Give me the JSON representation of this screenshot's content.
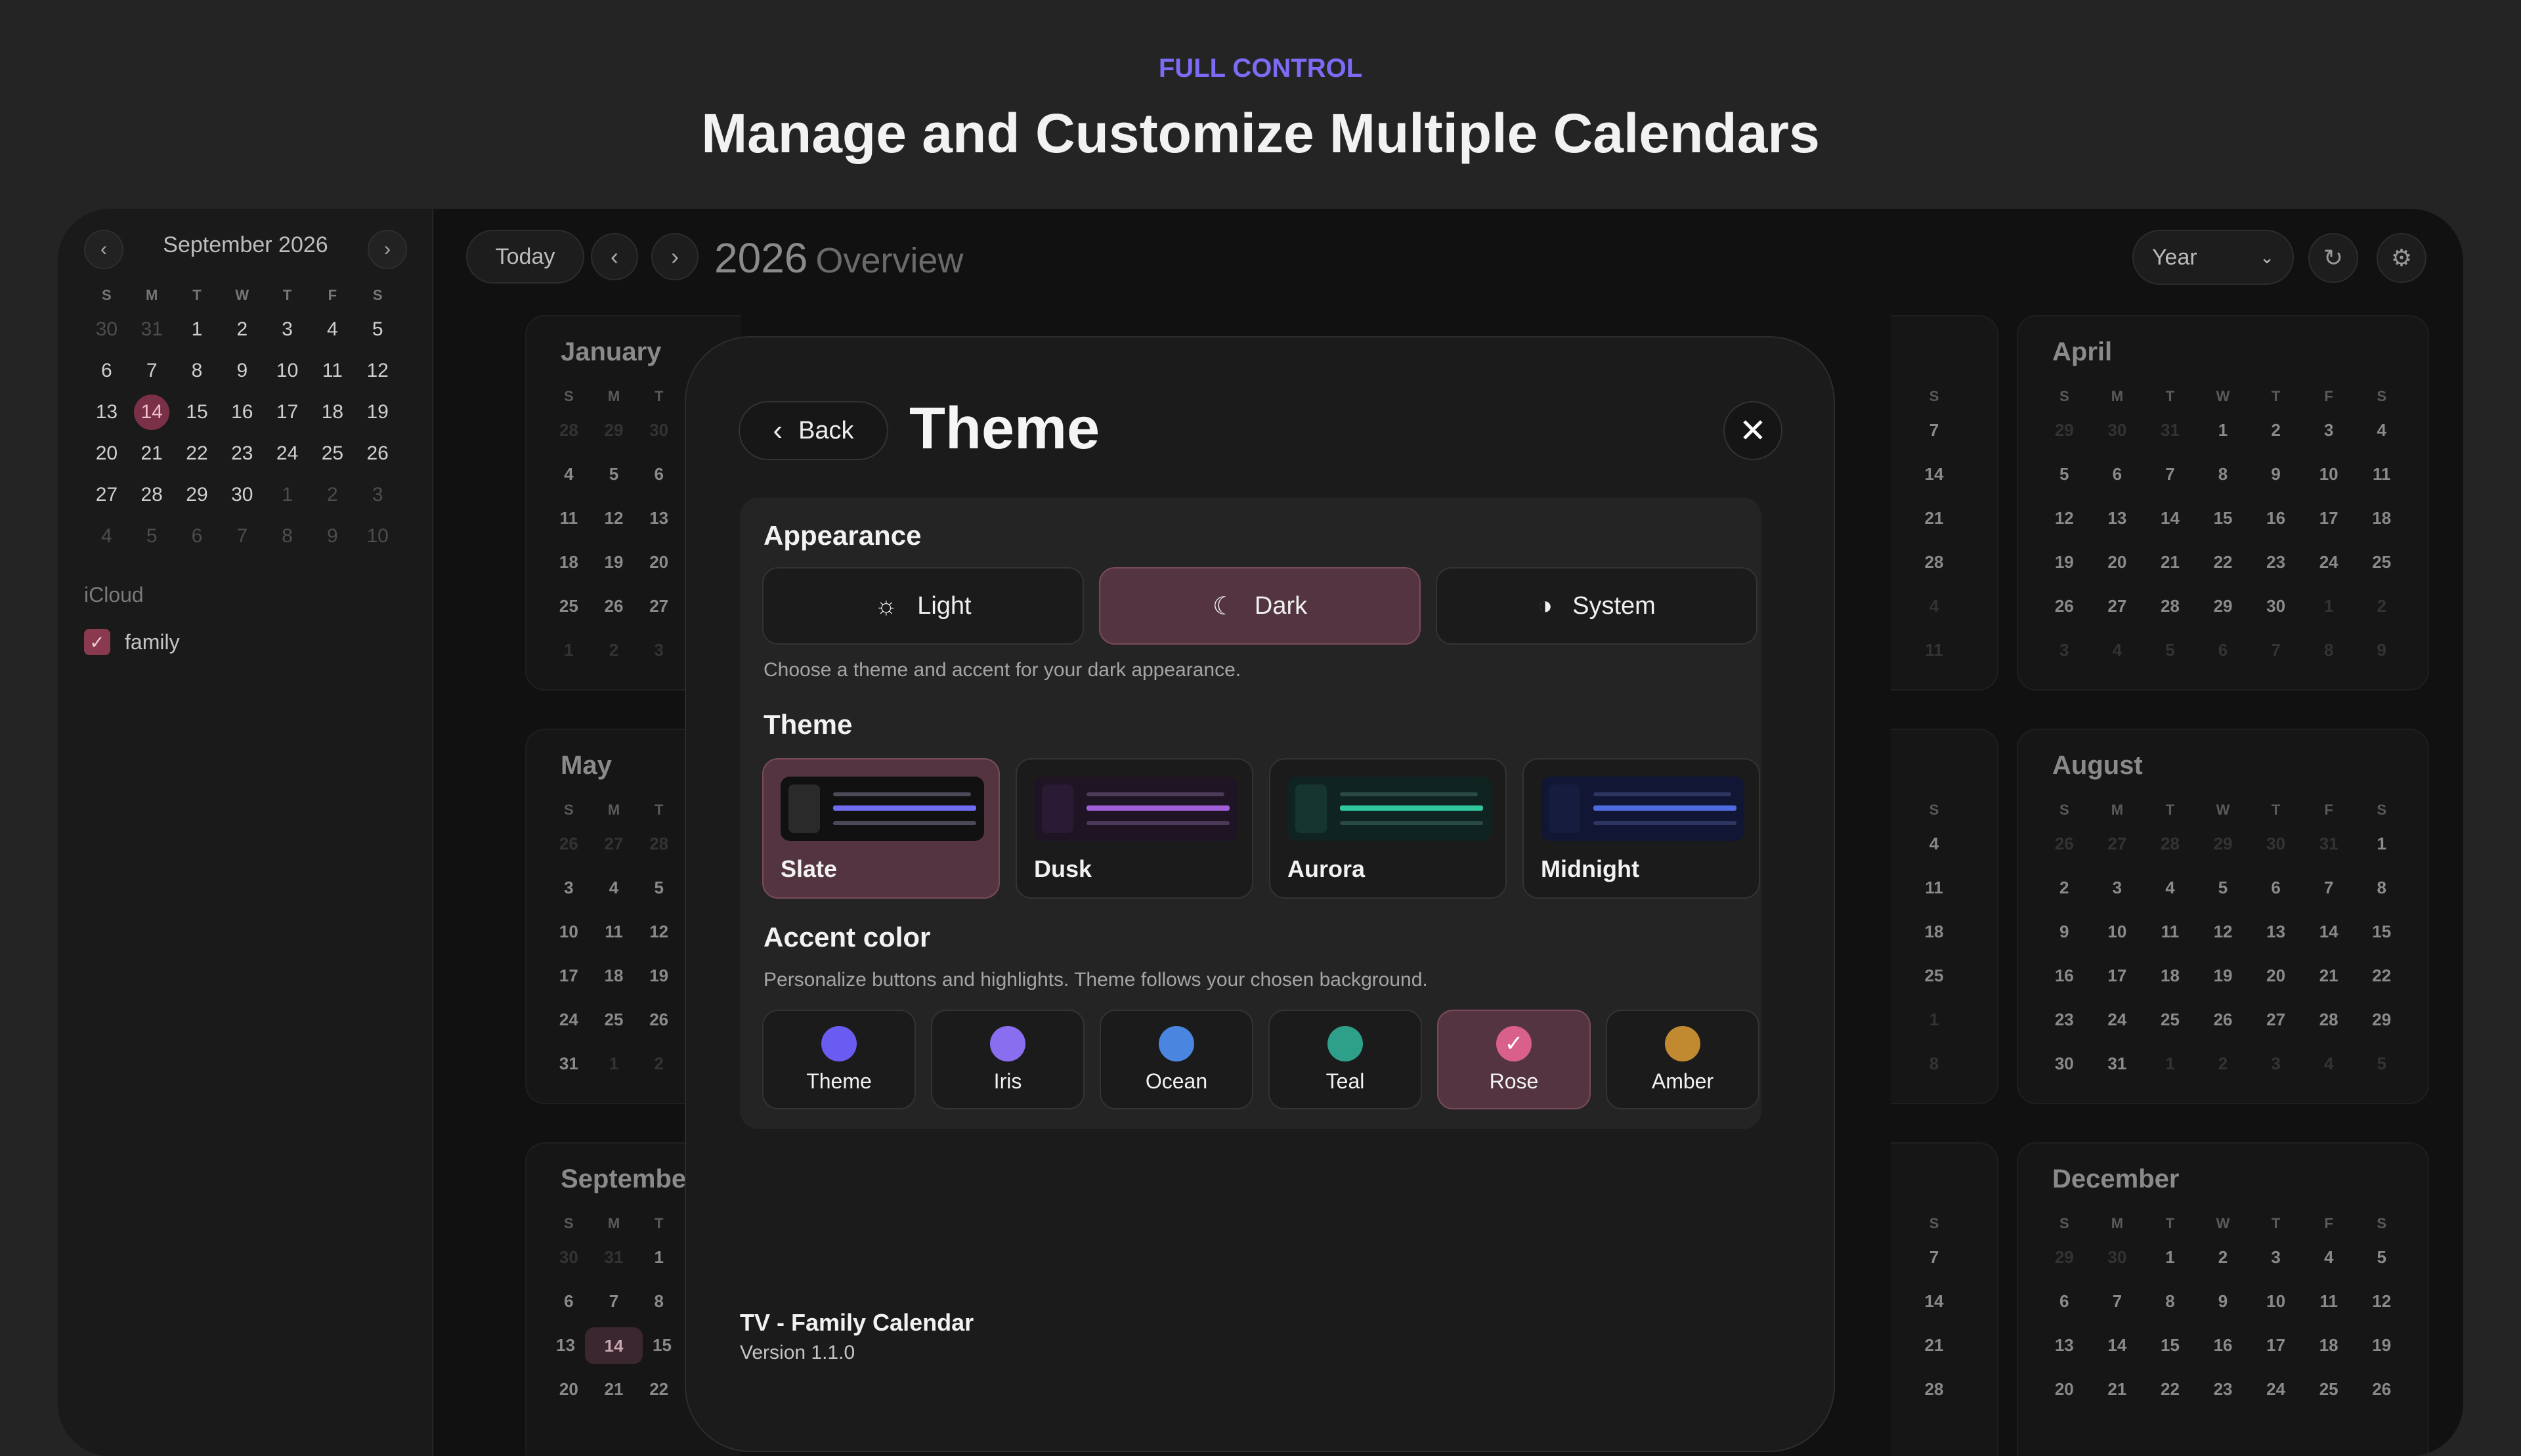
{
  "hero": {
    "eyebrow": "FULL CONTROL",
    "title": "Manage and Customize Multiple Calendars"
  },
  "sidebar": {
    "mini_calendar": {
      "title": "September 2026",
      "weekdays": [
        "S",
        "M",
        "T",
        "W",
        "T",
        "F",
        "S"
      ],
      "weeks": [
        [
          {
            "d": "30",
            "dim": true
          },
          {
            "d": "31",
            "dim": true
          },
          {
            "d": "1"
          },
          {
            "d": "2"
          },
          {
            "d": "3"
          },
          {
            "d": "4"
          },
          {
            "d": "5"
          }
        ],
        [
          {
            "d": "6"
          },
          {
            "d": "7"
          },
          {
            "d": "8"
          },
          {
            "d": "9"
          },
          {
            "d": "10"
          },
          {
            "d": "11"
          },
          {
            "d": "12"
          }
        ],
        [
          {
            "d": "13"
          },
          {
            "d": "14",
            "today": true
          },
          {
            "d": "15"
          },
          {
            "d": "16"
          },
          {
            "d": "17"
          },
          {
            "d": "18"
          },
          {
            "d": "19"
          }
        ],
        [
          {
            "d": "20"
          },
          {
            "d": "21"
          },
          {
            "d": "22"
          },
          {
            "d": "23"
          },
          {
            "d": "24"
          },
          {
            "d": "25"
          },
          {
            "d": "26"
          }
        ],
        [
          {
            "d": "27"
          },
          {
            "d": "28"
          },
          {
            "d": "29"
          },
          {
            "d": "30"
          },
          {
            "d": "1",
            "dim": true
          },
          {
            "d": "2",
            "dim": true
          },
          {
            "d": "3",
            "dim": true
          }
        ],
        [
          {
            "d": "4",
            "dim": true
          },
          {
            "d": "5",
            "dim": true
          },
          {
            "d": "6",
            "dim": true
          },
          {
            "d": "7",
            "dim": true
          },
          {
            "d": "8",
            "dim": true
          },
          {
            "d": "9",
            "dim": true
          },
          {
            "d": "10",
            "dim": true
          }
        ]
      ]
    },
    "account_label": "iCloud",
    "calendar_name": "family"
  },
  "toolbar": {
    "today_label": "Today",
    "year": "2026",
    "view_title": "Overview",
    "view_select": "Year"
  },
  "year_overview": {
    "weekdays": [
      "S",
      "M",
      "T",
      "W",
      "T",
      "F",
      "S"
    ],
    "months": [
      {
        "name": "January",
        "weeks": [
          [
            "28",
            "29",
            "30"
          ],
          [
            "4",
            "5",
            "6"
          ],
          [
            "11",
            "12",
            "13"
          ],
          [
            "18",
            "19",
            "20"
          ],
          [
            "25",
            "26",
            "27"
          ],
          [
            "1",
            "2",
            "3"
          ]
        ],
        "dim": [
          [
            0,
            0
          ],
          [
            0,
            1
          ],
          [
            0,
            2
          ],
          [
            5,
            0
          ],
          [
            5,
            1
          ],
          [
            5,
            2
          ]
        ]
      },
      {
        "name": "May",
        "weeks": [
          [
            "26",
            "27",
            "28"
          ],
          [
            "3",
            "4",
            "5"
          ],
          [
            "10",
            "11",
            "12"
          ],
          [
            "17",
            "18",
            "19"
          ],
          [
            "24",
            "25",
            "26"
          ],
          [
            "31",
            "1",
            "2"
          ]
        ],
        "dim": [
          [
            0,
            0
          ],
          [
            0,
            1
          ],
          [
            0,
            2
          ],
          [
            5,
            1
          ],
          [
            5,
            2
          ]
        ]
      },
      {
        "name": "September",
        "weeks": [
          [
            "30",
            "31",
            "1"
          ],
          [
            "6",
            "7",
            "8"
          ],
          [
            "13",
            "14",
            "15"
          ],
          [
            "20",
            "21",
            "22"
          ]
        ],
        "dim": [
          [
            0,
            0
          ],
          [
            0,
            1
          ]
        ],
        "selected": [
          2,
          1
        ]
      },
      {
        "name": "April",
        "weeks": [
          [
            "29",
            "30",
            "31",
            "1",
            "2",
            "3",
            "4"
          ],
          [
            "5",
            "6",
            "7",
            "8",
            "9",
            "10",
            "11"
          ],
          [
            "12",
            "13",
            "14",
            "15",
            "16",
            "17",
            "18"
          ],
          [
            "19",
            "20",
            "21",
            "22",
            "23",
            "24",
            "25"
          ],
          [
            "26",
            "27",
            "28",
            "29",
            "30",
            "1",
            "2"
          ],
          [
            "3",
            "4",
            "5",
            "6",
            "7",
            "8",
            "9"
          ]
        ],
        "dim": [
          [
            0,
            0
          ],
          [
            0,
            1
          ],
          [
            0,
            2
          ],
          [
            4,
            5
          ],
          [
            4,
            6
          ],
          [
            5,
            0
          ],
          [
            5,
            1
          ],
          [
            5,
            2
          ],
          [
            5,
            3
          ],
          [
            5,
            4
          ],
          [
            5,
            5
          ],
          [
            5,
            6
          ]
        ]
      },
      {
        "name": "August",
        "weeks": [
          [
            "26",
            "27",
            "28",
            "29",
            "30",
            "31",
            "1"
          ],
          [
            "2",
            "3",
            "4",
            "5",
            "6",
            "7",
            "8"
          ],
          [
            "9",
            "10",
            "11",
            "12",
            "13",
            "14",
            "15"
          ],
          [
            "16",
            "17",
            "18",
            "19",
            "20",
            "21",
            "22"
          ],
          [
            "23",
            "24",
            "25",
            "26",
            "27",
            "28",
            "29"
          ],
          [
            "30",
            "31",
            "1",
            "2",
            "3",
            "4",
            "5"
          ]
        ],
        "dim": [
          [
            0,
            0
          ],
          [
            0,
            1
          ],
          [
            0,
            2
          ],
          [
            0,
            3
          ],
          [
            0,
            4
          ],
          [
            0,
            5
          ],
          [
            5,
            2
          ],
          [
            5,
            3
          ],
          [
            5,
            4
          ],
          [
            5,
            5
          ],
          [
            5,
            6
          ]
        ]
      },
      {
        "name": "December",
        "weeks": [
          [
            "29",
            "30",
            "1",
            "2",
            "3",
            "4",
            "5"
          ],
          [
            "6",
            "7",
            "8",
            "9",
            "10",
            "11",
            "12"
          ],
          [
            "13",
            "14",
            "15",
            "16",
            "17",
            "18",
            "19"
          ],
          [
            "20",
            "21",
            "22",
            "23",
            "24",
            "25",
            "26"
          ]
        ],
        "dim": [
          [
            0,
            0
          ],
          [
            0,
            1
          ]
        ]
      }
    ],
    "peek_columns": [
      {
        "head": "S",
        "days": [
          "7",
          "14",
          "21",
          "28",
          "4",
          "11"
        ],
        "dim": [
          4,
          5
        ]
      },
      {
        "head": "S",
        "days": [
          "4",
          "11",
          "18",
          "25",
          "1",
          "8"
        ],
        "dim": [
          4,
          5
        ]
      },
      {
        "head": "S",
        "days": [
          "7",
          "14",
          "21",
          "28"
        ],
        "dim": []
      }
    ]
  },
  "modal": {
    "back_label": "Back",
    "title": "Theme",
    "appearance": {
      "heading": "Appearance",
      "options": [
        "Light",
        "Dark",
        "System"
      ],
      "selected": "Dark",
      "hint": "Choose a theme and accent for your dark appearance."
    },
    "theme": {
      "heading": "Theme",
      "options": [
        {
          "label": "Slate",
          "bg": "#111111",
          "block": "#2a2a2a",
          "line1": "#6f6cf0",
          "line2": "#4a4a58",
          "selected": true
        },
        {
          "label": "Dusk",
          "bg": "#1e1424",
          "block": "#2b1a33",
          "line1": "#a05fd8",
          "line2": "#4d3a58"
        },
        {
          "label": "Aurora",
          "bg": "#0f2420",
          "block": "#163430",
          "line1": "#2fc6a0",
          "line2": "#2a4a44"
        },
        {
          "label": "Midnight",
          "bg": "#101633",
          "block": "#151c3e",
          "line1": "#4f6be0",
          "line2": "#2c3660"
        }
      ]
    },
    "accent": {
      "heading": "Accent color",
      "hint": "Personalize buttons and highlights. Theme follows your chosen background.",
      "options": [
        {
          "label": "Theme",
          "color": "#6a5cf0"
        },
        {
          "label": "Iris",
          "color": "#8a6ef0"
        },
        {
          "label": "Ocean",
          "color": "#4a86e0"
        },
        {
          "label": "Teal",
          "color": "#2ea08a"
        },
        {
          "label": "Rose",
          "color": "#d9608a",
          "selected": true
        },
        {
          "label": "Amber",
          "color": "#c28a30"
        }
      ]
    },
    "app_name": "TV - Family Calendar",
    "app_version": "Version 1.1.0"
  }
}
